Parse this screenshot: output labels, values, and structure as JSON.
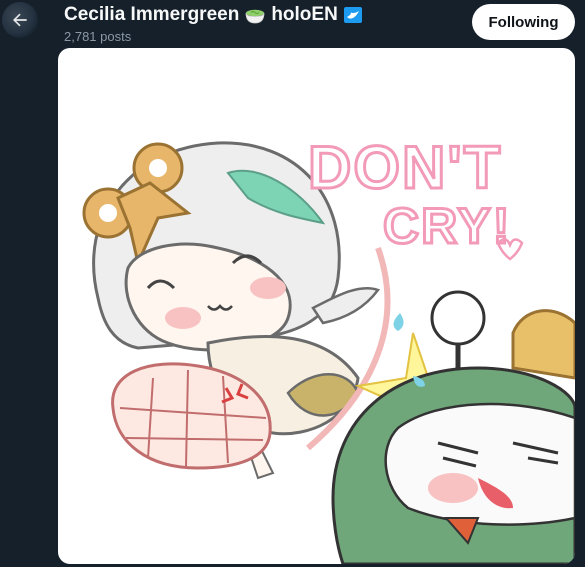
{
  "header": {
    "display_name": "Cecilia Immergreen",
    "affiliation": "holoEN",
    "post_count": "2,781 posts",
    "follow_label": "Following"
  },
  "artwork": {
    "speech_line1": "DON'T",
    "speech_line2": "CRY!"
  },
  "colors": {
    "background": "#15202b",
    "follow_button": "#ffffff",
    "verified_blue": "#1d9bf0",
    "lettering_pink": "#f7a8c0"
  },
  "icons": {
    "back": "arrow-left-icon",
    "tea": "matcha-teacup-icon",
    "verified": "verified-badge-icon"
  }
}
